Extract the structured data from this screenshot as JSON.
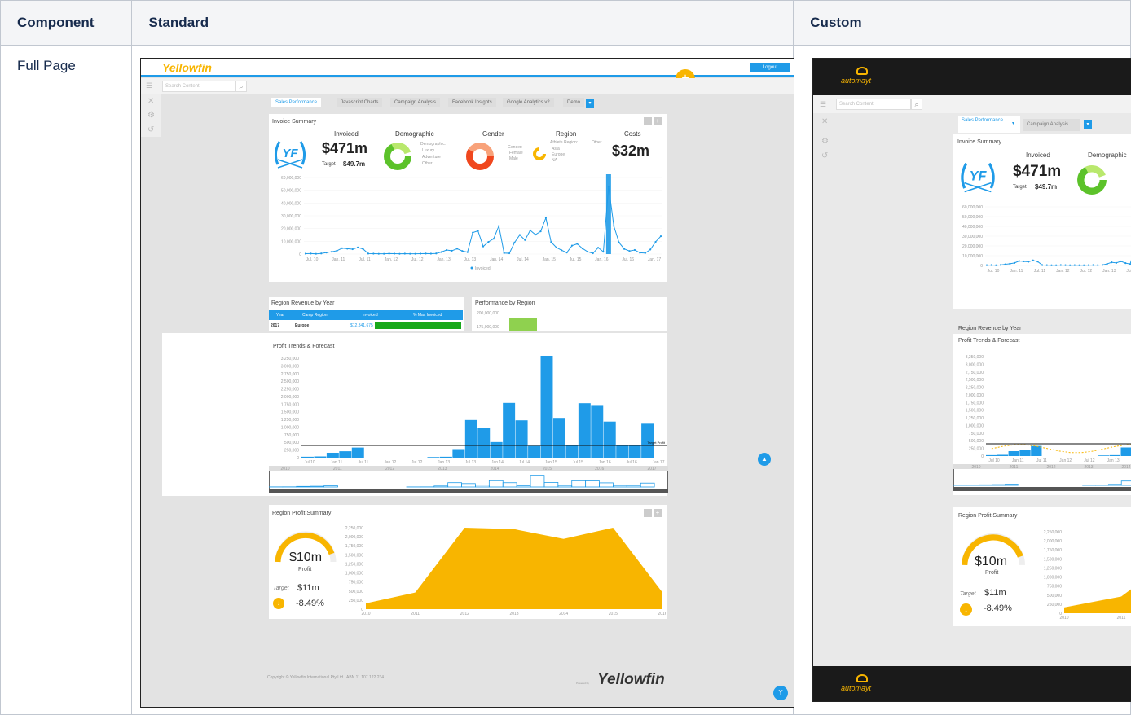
{
  "table": {
    "headers": [
      "Component",
      "Standard",
      "Custom"
    ],
    "row_label": "Full Page"
  },
  "standard": {
    "brand": "Yellowfin",
    "logout": "Logout",
    "search_placeholder": "Search Content",
    "tabs": [
      "Sales Performance",
      "Javascript Charts",
      "Campaign Analysis",
      "Facebook Insights",
      "Google Analytics v2",
      "Demo"
    ],
    "invoice_summary": {
      "title": "Invoice Summary",
      "invoiced_label": "Invoiced",
      "invoiced_value": "$471m",
      "target_label": "Target",
      "target_value": "$49.7m",
      "demographic_label": "Demographic",
      "demographic_legend_title": "Demographic:",
      "demographic_legend": [
        "Luxury",
        "Adventure",
        "Other"
      ],
      "gender_label": "Gender",
      "gender_legend_title": "Gender:",
      "gender_legend": [
        "Female",
        "Male"
      ],
      "region_label": "Region",
      "region_legend_title": "Athlete Region:",
      "region_legend": [
        "Asia",
        "Europe",
        "NA",
        "Other"
      ],
      "costs_label": "Costs",
      "costs_value": "$32m",
      "annotation": "Marketing Campaign",
      "legend": "Invoiced"
    },
    "region_revenue": {
      "title": "Region Revenue by Year",
      "columns": [
        "Year",
        "Camp Region",
        "Invoiced",
        "% Max Invoiced"
      ],
      "row": [
        "2017",
        "Europe",
        "$12,341,675"
      ]
    },
    "performance_by_region": {
      "title": "Performance by Region",
      "ticks": [
        "200,000,000",
        "175,000,000"
      ]
    },
    "profit_trends": {
      "title": "Profit Trends & Forecast",
      "target_label": "Target Profit"
    },
    "region_profit": {
      "title": "Region Profit Summary",
      "profit_value": "$10m",
      "profit_label": "Profit",
      "target_label": "Target",
      "target_value": "$11m",
      "change": "-8.49%"
    },
    "footer_copyright": "Copyright © Yellowfin International Pty Ltd | ABN 11 107 122 234",
    "footer_powered": "Powered by",
    "footer_brand": "Yellowfin"
  },
  "custom": {
    "brand": "automayt",
    "search_placeholder": "Search Content",
    "tabs": [
      "Sales Performance",
      "Campaign Analysis"
    ],
    "invoice_summary": {
      "title": "Invoice Summary",
      "invoiced_label": "Invoiced",
      "invoiced_value": "$471m",
      "target_label": "Target",
      "target_value": "$49.7m",
      "demographic_label": "Demographic"
    },
    "region_revenue_title": "Region Revenue by Year",
    "profit_trends_title": "Profit Trends & Forecast",
    "region_profit": {
      "title": "Region Profit Summary",
      "profit_value": "$10m",
      "profit_label": "Profit",
      "target_label": "Target",
      "target_value": "$11m",
      "change": "-8.49%"
    }
  },
  "axes": {
    "invoice_y": [
      "60,000,000",
      "50,000,000",
      "40,000,000",
      "30,000,000",
      "20,000,000",
      "10,000,000",
      "0"
    ],
    "invoice_x": [
      "Jul. 10",
      "Jan. 11",
      "Jul. 11",
      "Jan. 12",
      "Jul. 12",
      "Jan. 13",
      "Jul. 13",
      "Jan. 14",
      "Jul. 14",
      "Jan. 15",
      "Jul. 15",
      "Jan. 16",
      "Jul. 16",
      "Jan. 17"
    ],
    "profit_y": [
      "3,250,000",
      "3,000,000",
      "2,750,000",
      "2,500,000",
      "2,250,000",
      "2,000,000",
      "1,750,000",
      "1,500,000",
      "1,250,000",
      "1,000,000",
      "750,000",
      "500,000",
      "250,000",
      "0"
    ],
    "profit_x": [
      "Jul 10",
      "Jan 11",
      "Jul 11",
      "Jan 12",
      "Jul 12",
      "Jan 13",
      "Jul 13",
      "Jan 14",
      "Jul 14",
      "Jan 15",
      "Jul 15",
      "Jan 16",
      "Jul 16",
      "Jan 17"
    ],
    "years": [
      "2010",
      "2011",
      "2012",
      "2013",
      "2014",
      "2015",
      "2016",
      "2017"
    ],
    "region_y": [
      "2,250,000",
      "2,000,000",
      "1,750,000",
      "1,500,000",
      "1,250,000",
      "1,000,000",
      "750,000",
      "500,000",
      "250,000",
      "0"
    ],
    "region_x": [
      "2010",
      "2011",
      "2012",
      "2013",
      "2014",
      "2015",
      "2016"
    ]
  },
  "colors": {
    "accent_blue": "#1f9be8",
    "yellow": "#f8b500",
    "green": "#5cc22a",
    "orange_red": "#f0471e",
    "automayt_bg": "#1a1a1a"
  },
  "chart_data": [
    {
      "type": "line",
      "title": "Invoice Summary",
      "series": [
        {
          "name": "Invoiced",
          "values": [
            0.3,
            0.4,
            0.2,
            0.5,
            1.2,
            1.8,
            2.6,
            4.6,
            4.2,
            3.8,
            5.2,
            4.0,
            0.4,
            0.3,
            0.2,
            0.2,
            0.4,
            0.3,
            0.2,
            0.3,
            0.2,
            0.2,
            0.3,
            0.4,
            0.3,
            0.5,
            1.6,
            3.2,
            2.6,
            4.2,
            2.4,
            1.5,
            16.8,
            18.2,
            6.0,
            9.5,
            12.0,
            22.0,
            0.8,
            0.6,
            9.0,
            15.0,
            11.0,
            18.6,
            15.2,
            17.8,
            28.4,
            9.4,
            5.2,
            3.0,
            1.2,
            6.6,
            8.0,
            4.4,
            1.8,
            0.6,
            5.0,
            1.8,
            53.0,
            22.0,
            9.0,
            4.0,
            2.4,
            3.2,
            1.0,
            0.8,
            3.6,
            9.6,
            14.0
          ]
        }
      ],
      "ylim": [
        0,
        60000000
      ]
    },
    {
      "type": "bar",
      "title": "Profit Trends & Forecast",
      "values": [
        30000,
        40000,
        160000,
        210000,
        330000,
        0,
        0,
        0,
        0,
        0,
        20000,
        30000,
        280000,
        1230000,
        970000,
        510000,
        1790000,
        1220000,
        380000,
        3330000,
        1300000,
        420000,
        1780000,
        1720000,
        1180000,
        420000,
        410000,
        1110000,
        0
      ],
      "ylim": [
        0,
        3250000
      ]
    },
    {
      "type": "area",
      "title": "Region Profit Summary",
      "categories": [
        "2010",
        "2011",
        "2012",
        "2013",
        "2014",
        "2015",
        "2016"
      ],
      "values": [
        160000,
        460000,
        2350000,
        2210000,
        1940000,
        2280000,
        460000
      ],
      "ylim": [
        0,
        2250000
      ]
    }
  ]
}
